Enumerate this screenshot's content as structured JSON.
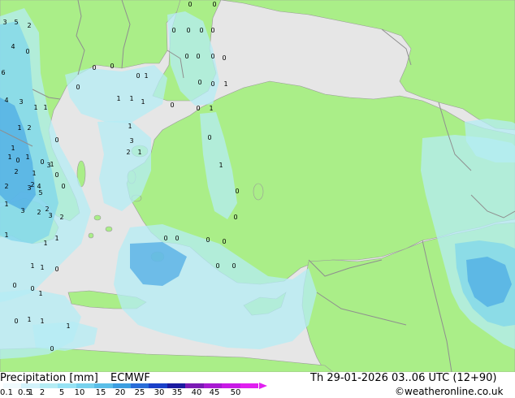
{
  "title": "Precipitation [mm]",
  "model": "ECMWF",
  "valid_time": "Th 29-01-2026 03..06 UTC (12+90)",
  "credit": "©weatheronline.co.uk",
  "colors": {
    "land": "#aaee88",
    "sea": "#e6e6e6",
    "border": "#8f8f8f",
    "precip_light": "#b4ecf4",
    "precip_mid": "#7cd4ec",
    "precip_heavy": "#48a8e4"
  },
  "legend": {
    "labels": [
      "0.1",
      "0.5",
      "1",
      "2",
      "5",
      "10",
      "15",
      "20",
      "25",
      "30",
      "35",
      "40",
      "45",
      "50"
    ],
    "colors": [
      "#f0fafd",
      "#d2f2fa",
      "#b4ecf4",
      "#96e2f4",
      "#78d2ee",
      "#5abee8",
      "#3c9ee0",
      "#2a6ed8",
      "#1a40c8",
      "#1a1aa0",
      "#7a1ab4",
      "#a81ad2",
      "#c81ae6",
      "#e020f0"
    ]
  },
  "amounts": {
    "values": [
      "3",
      "5",
      "4",
      "6",
      "3",
      "4",
      "2",
      "0",
      "1",
      "1",
      "1",
      "2",
      "1",
      "0",
      "1",
      "1",
      "0",
      "0",
      "1",
      "1",
      "0",
      "2",
      "2",
      "2",
      "4",
      "3",
      "0",
      "5",
      "3",
      "2",
      "1",
      "2",
      "3",
      "3",
      "2",
      "1",
      "1",
      "1",
      "1",
      "1",
      "0",
      "0",
      "0",
      "1",
      "1",
      "1",
      "0",
      "0",
      "1",
      "0",
      "0",
      "0",
      "0",
      "1",
      "1",
      "1",
      "1",
      "0",
      "0",
      "1",
      "0",
      "0",
      "0",
      "0",
      "0",
      "0",
      "0",
      "0",
      "0",
      "0",
      "1",
      "1",
      "3",
      "2",
      "1",
      "0",
      "1",
      "0",
      "0",
      "0",
      "0",
      "0",
      "0",
      "0",
      "0",
      "0",
      "0"
    ]
  }
}
